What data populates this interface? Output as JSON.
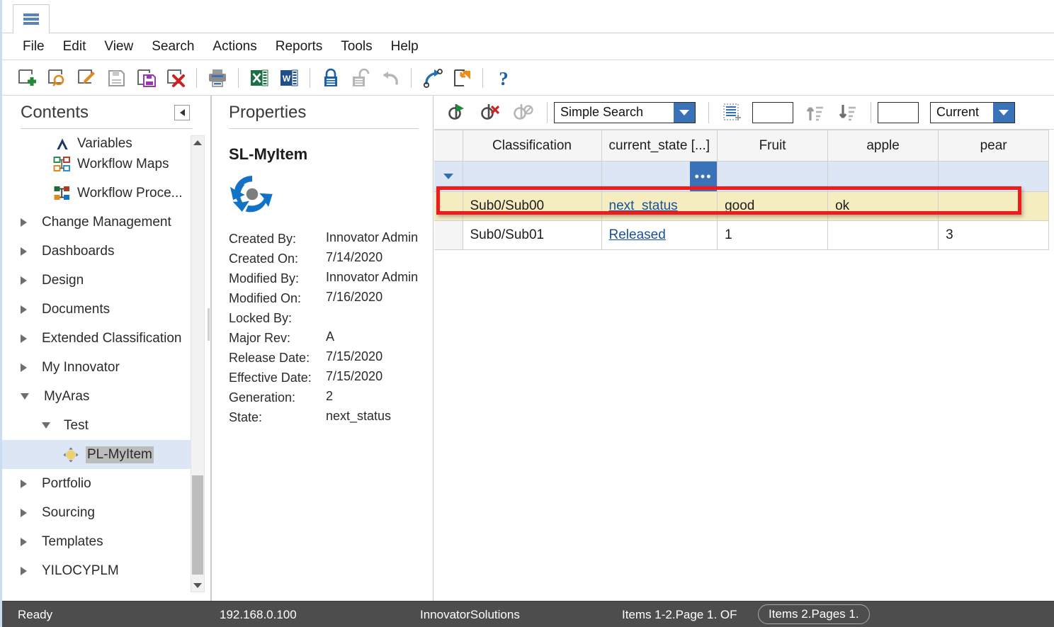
{
  "window": {
    "tab_icon": "hamburger-menu-icon"
  },
  "menubar": {
    "items": [
      "File",
      "Edit",
      "View",
      "Search",
      "Actions",
      "Reports",
      "Tools",
      "Help"
    ]
  },
  "toolbar": {
    "buttons": [
      {
        "name": "new-item-icon",
        "tip": "New"
      },
      {
        "name": "search-item-icon",
        "tip": "Search"
      },
      {
        "name": "edit-item-icon",
        "tip": "Edit"
      },
      {
        "name": "save-icon",
        "tip": "Save"
      },
      {
        "name": "save-and-close-icon",
        "tip": "Save and Close"
      },
      {
        "name": "delete-item-icon",
        "tip": "Delete"
      },
      {
        "name": "print-icon",
        "tip": "Print"
      },
      {
        "name": "export-excel-icon",
        "tip": "Export to Excel"
      },
      {
        "name": "export-word-icon",
        "tip": "Export to Word"
      },
      {
        "name": "lock-icon",
        "tip": "Lock"
      },
      {
        "name": "unlock-icon",
        "tip": "Unlock"
      },
      {
        "name": "undo-icon",
        "tip": "Undo"
      },
      {
        "name": "promote-icon",
        "tip": "Promote"
      },
      {
        "name": "copy-item-icon",
        "tip": "Copy"
      },
      {
        "name": "help-icon",
        "tip": "Help"
      }
    ]
  },
  "contents": {
    "title": "Contents",
    "collapse_icon": "collapse-left-icon",
    "tree": [
      {
        "label": "Variables",
        "indent": 2,
        "twisty": "none",
        "icon": "variables-icon",
        "clipped": true
      },
      {
        "label": "Workflow Maps",
        "indent": 2,
        "twisty": "none",
        "icon": "workflow-maps-icon"
      },
      {
        "label": "Workflow Proce...",
        "indent": 2,
        "twisty": "none",
        "icon": "workflow-process-icon"
      },
      {
        "label": "Change Management",
        "indent": 0,
        "twisty": "collapsed",
        "icon": "none"
      },
      {
        "label": "Dashboards",
        "indent": 0,
        "twisty": "collapsed",
        "icon": "none"
      },
      {
        "label": "Design",
        "indent": 0,
        "twisty": "collapsed",
        "icon": "none"
      },
      {
        "label": "Documents",
        "indent": 0,
        "twisty": "collapsed",
        "icon": "none"
      },
      {
        "label": "Extended Classification",
        "indent": 0,
        "twisty": "collapsed",
        "icon": "none"
      },
      {
        "label": "My Innovator",
        "indent": 0,
        "twisty": "collapsed",
        "icon": "none"
      },
      {
        "label": "MyAras",
        "indent": 0,
        "twisty": "expanded",
        "icon": "none"
      },
      {
        "label": "Test",
        "indent": 1,
        "twisty": "expanded",
        "icon": "none"
      },
      {
        "label": "PL-MyItem",
        "indent": 2,
        "twisty": "none",
        "icon": "pl-myitem-icon",
        "selected": true,
        "text_highlight": true
      },
      {
        "label": "Portfolio",
        "indent": 0,
        "twisty": "collapsed",
        "icon": "none"
      },
      {
        "label": "Sourcing",
        "indent": 0,
        "twisty": "collapsed",
        "icon": "none"
      },
      {
        "label": "Templates",
        "indent": 0,
        "twisty": "collapsed",
        "icon": "none"
      },
      {
        "label": "YILOCYPLM",
        "indent": 0,
        "twisty": "collapsed",
        "icon": "none"
      }
    ]
  },
  "properties": {
    "title": "Properties",
    "item_name": "SL-MyItem",
    "logo_icon": "aras-innovator-logo-icon",
    "fields": [
      {
        "label": "Created By:",
        "value": "Innovator Admin"
      },
      {
        "label": "Created On:",
        "value": "7/14/2020"
      },
      {
        "label": "Modified By:",
        "value": "Innovator Admin"
      },
      {
        "label": "Modified On:",
        "value": "7/16/2020"
      },
      {
        "label": "Locked By:",
        "value": ""
      },
      {
        "label": "Major Rev:",
        "value": "A"
      },
      {
        "label": "Release Date:",
        "value": "7/15/2020"
      },
      {
        "label": "Effective Date:",
        "value": "7/15/2020"
      },
      {
        "label": "Generation:",
        "value": "2"
      },
      {
        "label": "State:",
        "value": "next_status"
      }
    ]
  },
  "search": {
    "run_search_icon": "run-search-icon",
    "clear_search_icon": "clear-search-icon",
    "disable_search_icon": "disable-search-icon",
    "mode_value": "Simple Search",
    "saved_search_icon": "saved-search-icon",
    "page_size_value": "",
    "sort_asc_icon": "sort-ascending-icon",
    "sort_desc_icon": "sort-descending-icon",
    "page_number_value": "",
    "revision_value": "Current"
  },
  "grid": {
    "columns": [
      "Classification",
      "current_state [...]",
      "Fruit",
      "apple",
      "pear"
    ],
    "filter_row": {
      "caret_icon": "filter-expand-icon",
      "ellipsis_label": "•••",
      "values": [
        "",
        "",
        "",
        "",
        ""
      ]
    },
    "rows": [
      {
        "highlighted": true,
        "cells": [
          "Sub0/Sub00",
          "next_status",
          "good",
          "ok",
          ""
        ],
        "link_col": 1
      },
      {
        "highlighted": false,
        "cells": [
          "Sub0/Sub01",
          "Released",
          "1",
          "",
          "3"
        ],
        "link_col": 1
      }
    ]
  },
  "statusbar": {
    "state": "Ready",
    "server": "192.168.0.100",
    "database": "InnovatorSolutions",
    "paging": "Items 1-2.Page 1. OF",
    "paging_pill": "Items 2.Pages 1."
  },
  "colors": {
    "accent_blue": "#3a72b8",
    "highlight_row": "#f5ecc0",
    "filter_row": "#dce6f5",
    "selection": "#dce6f5",
    "red_annotation": "#ee1c1c",
    "statusbar_bg": "#4d4d4d",
    "link": "#1a4f9c"
  }
}
